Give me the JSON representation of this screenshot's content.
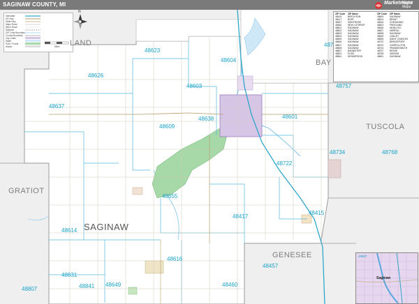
{
  "header": {
    "title": "SAGINAW COUNTY, MI",
    "logo_text": "Marketmaps",
    "logo_subtext": "Market Maps",
    "subtitle": "2022 ZIP Codes"
  },
  "legend": {
    "rows": [
      "Interstate",
      "US Hwy",
      "State Hwy",
      "Major Road",
      "Minor Road",
      "Railroad",
      "ZIP Code Boundary",
      "County Boundary",
      "City Limits",
      "Water",
      "Park / Forest",
      "Airport"
    ],
    "compass_label": "N",
    "scale_label": "Miles"
  },
  "counties": {
    "bay_north": "LAND",
    "bay": "BAY",
    "tuscola": "TUSCOLA",
    "gratiot": "GRATIOT",
    "saginaw": "SAGINAW",
    "genesee": "GENESEE"
  },
  "zip_labels": [
    {
      "code": "48623"
    },
    {
      "code": "48604"
    },
    {
      "code": "48626"
    },
    {
      "code": "48603"
    },
    {
      "code": "48757"
    },
    {
      "code": "48637"
    },
    {
      "code": "48638"
    },
    {
      "code": "48601"
    },
    {
      "code": "48609"
    },
    {
      "code": "48734"
    },
    {
      "code": "48768"
    },
    {
      "code": "48722"
    },
    {
      "code": "48655"
    },
    {
      "code": "48415"
    },
    {
      "code": "48417"
    },
    {
      "code": "48614"
    },
    {
      "code": "48616"
    },
    {
      "code": "48457"
    },
    {
      "code": "48807"
    },
    {
      "code": "48841"
    },
    {
      "code": "48649"
    },
    {
      "code": "48460"
    },
    {
      "code": "48831"
    },
    {
      "code": "48724"
    }
  ],
  "zip_table": {
    "headers": [
      "ZIP Code",
      "ZIP Name",
      "ZIP Code",
      "ZIP Name"
    ],
    "rows": [
      [
        "48415",
        "BIRCH RUN",
        "48609",
        "SAGINAW"
      ],
      [
        "48417",
        "BURT",
        "48614",
        "BRANT"
      ],
      [
        "48457",
        "MONTROSE",
        "48616",
        "CHESANING"
      ],
      [
        "48460",
        "NEW LOTHROP",
        "48623",
        "FREELAND"
      ],
      [
        "48601",
        "SAGINAW",
        "48626",
        "HEMLOCK"
      ],
      [
        "48602",
        "SAGINAW",
        "48637",
        "MERRILL"
      ],
      [
        "48603",
        "SAGINAW",
        "48638",
        "SAGINAW"
      ],
      [
        "48604",
        "SAGINAW",
        "48649",
        "OAKLEY"
      ],
      [
        "48605",
        "SAGINAW",
        "48655",
        "SAINT CHARLES"
      ],
      [
        "48606",
        "SAGINAW",
        "48722",
        "BRIDGEPORT"
      ],
      [
        "48607",
        "SAGINAW",
        "48724",
        "CARROLLTON"
      ],
      [
        "48608",
        "SAGINAW",
        "48734",
        "FRANKENMUTH"
      ],
      [
        "48807",
        "BANNISTER",
        "48757",
        "REESE"
      ],
      [
        "48831",
        "ELSIE",
        "48768",
        "VASSAR"
      ],
      [
        "48841",
        "HENDERSON",
        "48601",
        "SAGINAW"
      ]
    ]
  },
  "inset": {
    "city_label": "Saginaw",
    "zip_label": "48607"
  },
  "colors": {
    "zip_text": "#1aa3c7",
    "county_text": "#7d7d7d",
    "outside_fill": "#eeeeee",
    "park_fill": "#a6d8a8",
    "city_fill": "#d7c5e6",
    "water": "#cfe8f7"
  }
}
